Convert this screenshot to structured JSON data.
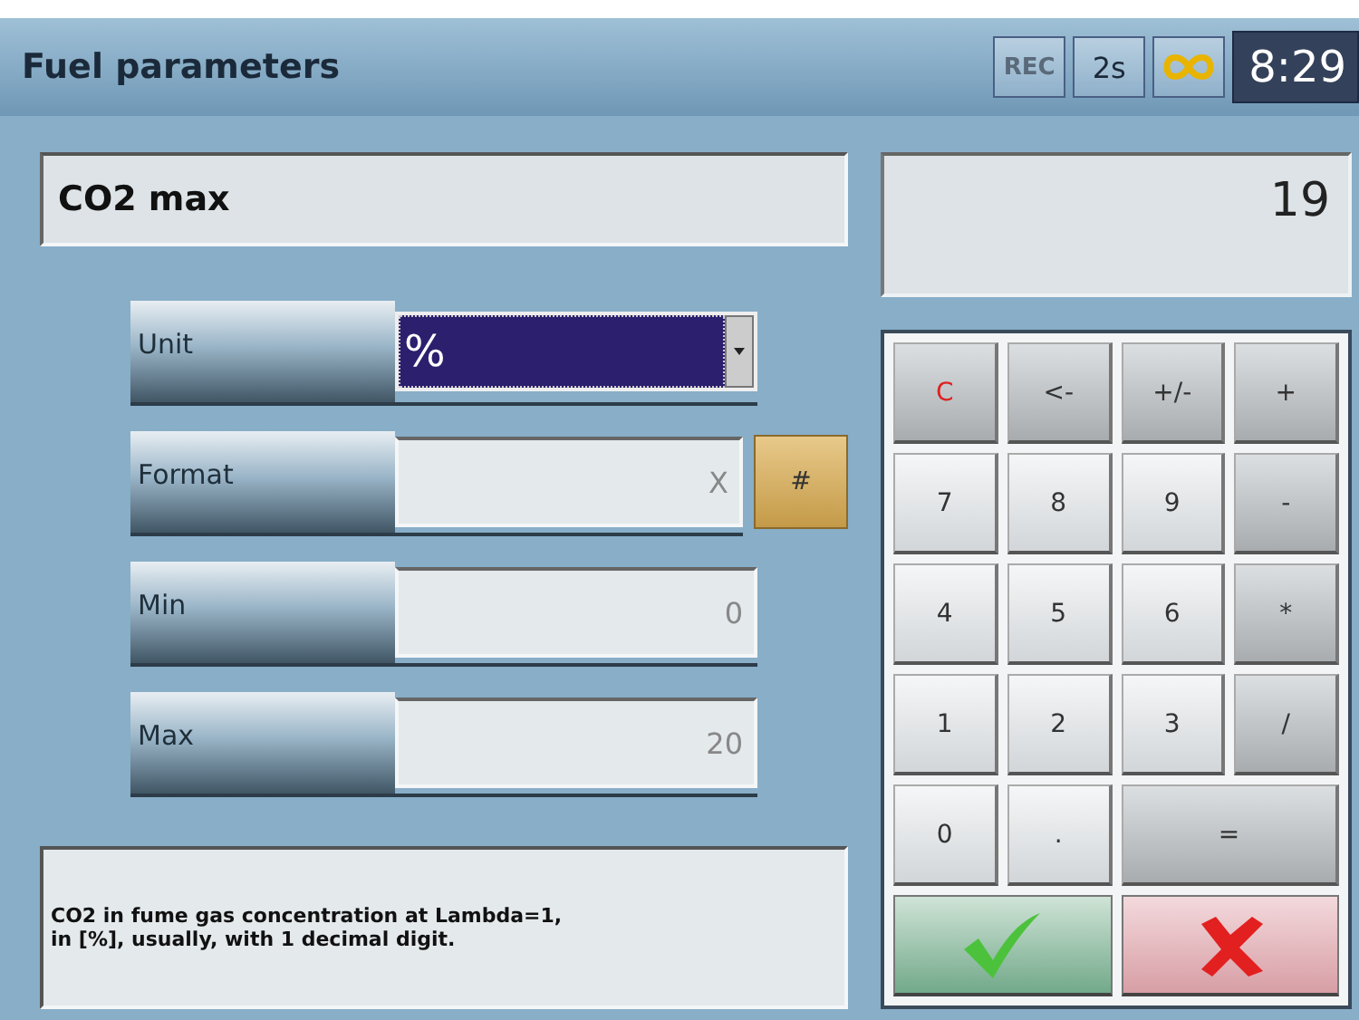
{
  "header": {
    "title": "Fuel parameters",
    "rec": "REC",
    "interval": "2s",
    "time": "8:29"
  },
  "parameter": {
    "name": "CO2 max"
  },
  "fields": [
    {
      "label": "Unit",
      "kind": "select",
      "value": "%"
    },
    {
      "label": "Format",
      "kind": "text",
      "value": "X",
      "action": "#"
    },
    {
      "label": "Min",
      "kind": "text",
      "value": "0"
    },
    {
      "label": "Max",
      "kind": "text",
      "value": "20"
    }
  ],
  "description": "CO2 in fume gas concentration at Lambda=1,\nin [%], usually, with 1 decimal digit.",
  "display": "19",
  "keys": [
    {
      "label": "C",
      "kind": "clear"
    },
    {
      "label": "<-",
      "kind": "op"
    },
    {
      "label": "+/-",
      "kind": "op"
    },
    {
      "label": "+",
      "kind": "op"
    },
    {
      "label": "7",
      "kind": "digit"
    },
    {
      "label": "8",
      "kind": "digit"
    },
    {
      "label": "9",
      "kind": "digit"
    },
    {
      "label": "-",
      "kind": "op"
    },
    {
      "label": "4",
      "kind": "digit"
    },
    {
      "label": "5",
      "kind": "digit"
    },
    {
      "label": "6",
      "kind": "digit"
    },
    {
      "label": "*",
      "kind": "op"
    },
    {
      "label": "1",
      "kind": "digit"
    },
    {
      "label": "2",
      "kind": "digit"
    },
    {
      "label": "3",
      "kind": "digit"
    },
    {
      "label": "/",
      "kind": "op"
    },
    {
      "label": "0",
      "kind": "digit"
    },
    {
      "label": ".",
      "kind": "digit"
    },
    {
      "label": "=",
      "kind": "wide"
    }
  ]
}
